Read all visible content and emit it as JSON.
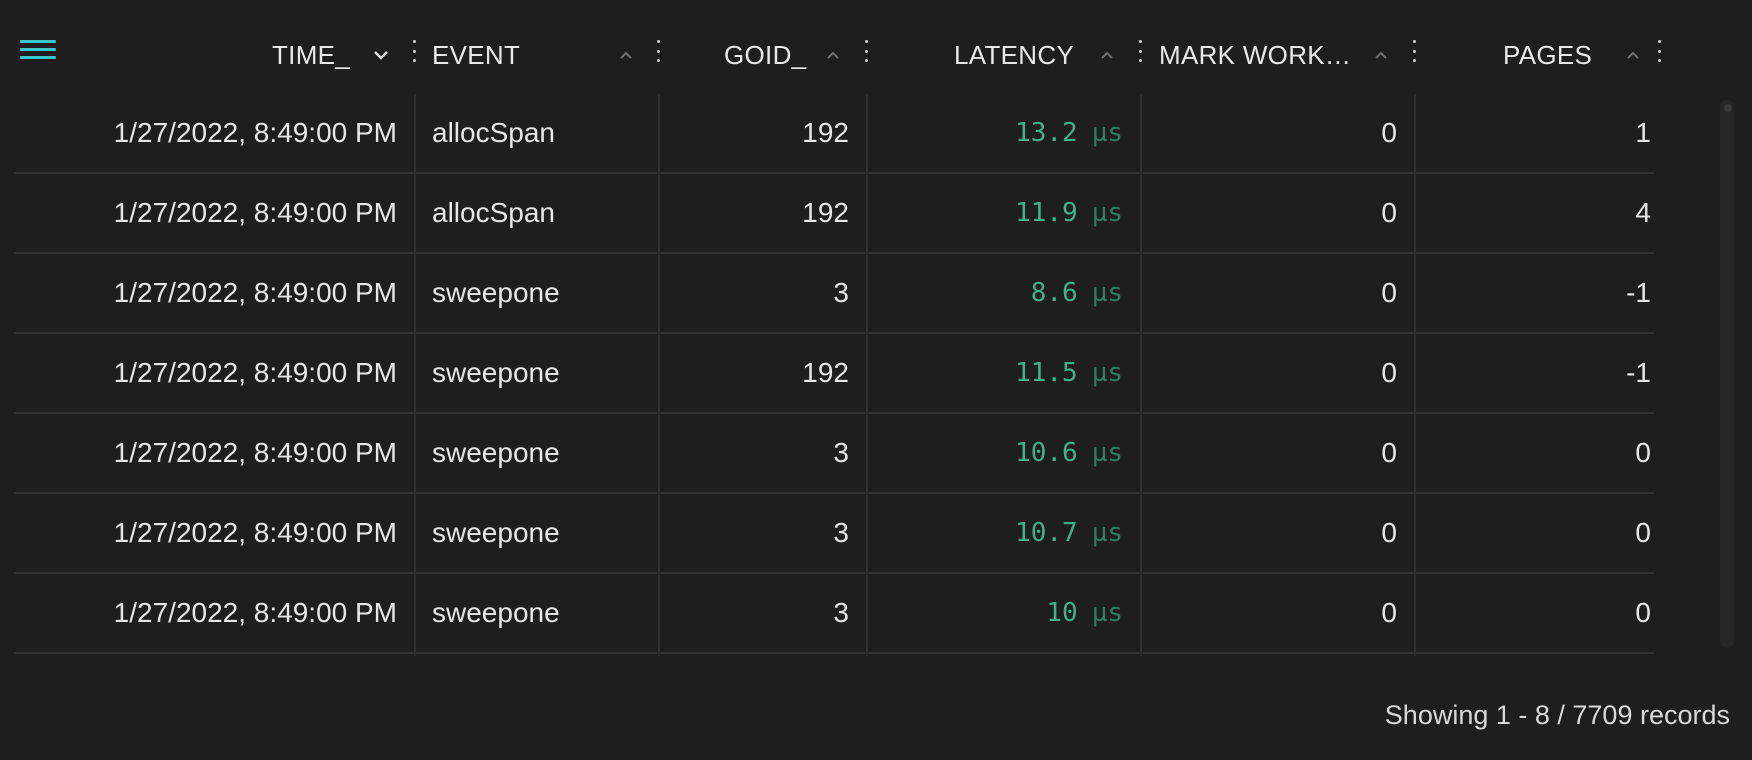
{
  "menu": {
    "icon": "hamburger-menu-icon"
  },
  "columns": [
    {
      "key": "time",
      "label": "TIME_",
      "sort": "desc"
    },
    {
      "key": "event",
      "label": "EVENT",
      "sort": "asc"
    },
    {
      "key": "goid",
      "label": "GOID_",
      "sort": "asc"
    },
    {
      "key": "latency",
      "label": "LATENCY",
      "sort": "asc"
    },
    {
      "key": "mark_work",
      "label": "MARK WORK…",
      "sort": "asc"
    },
    {
      "key": "pages",
      "label": "PAGES",
      "sort": "asc"
    }
  ],
  "rows": [
    {
      "time": "1/27/2022, 8:49:00 PM",
      "event": "allocSpan",
      "goid": "192",
      "latency": "13.2",
      "unit": "µs",
      "mark_work": "0",
      "pages": "1"
    },
    {
      "time": "1/27/2022, 8:49:00 PM",
      "event": "allocSpan",
      "goid": "192",
      "latency": "11.9",
      "unit": "µs",
      "mark_work": "0",
      "pages": "4"
    },
    {
      "time": "1/27/2022, 8:49:00 PM",
      "event": "sweepone",
      "goid": "3",
      "latency": "8.6",
      "unit": "µs",
      "mark_work": "0",
      "pages": "-1"
    },
    {
      "time": "1/27/2022, 8:49:00 PM",
      "event": "sweepone",
      "goid": "192",
      "latency": "11.5",
      "unit": "µs",
      "mark_work": "0",
      "pages": "-1"
    },
    {
      "time": "1/27/2022, 8:49:00 PM",
      "event": "sweepone",
      "goid": "3",
      "latency": "10.6",
      "unit": "µs",
      "mark_work": "0",
      "pages": "0"
    },
    {
      "time": "1/27/2022, 8:49:00 PM",
      "event": "sweepone",
      "goid": "3",
      "latency": "10.7",
      "unit": "µs",
      "mark_work": "0",
      "pages": "0"
    },
    {
      "time": "1/27/2022, 8:49:00 PM",
      "event": "sweepone",
      "goid": "3",
      "latency": "10",
      "unit": "µs",
      "mark_work": "0",
      "pages": "0"
    }
  ],
  "footer": {
    "status": "Showing 1 - 8 / 7709 records"
  },
  "colors": {
    "accent": "#35c6cc",
    "latency": "#3fb28a",
    "background": "#1e1e1e"
  }
}
